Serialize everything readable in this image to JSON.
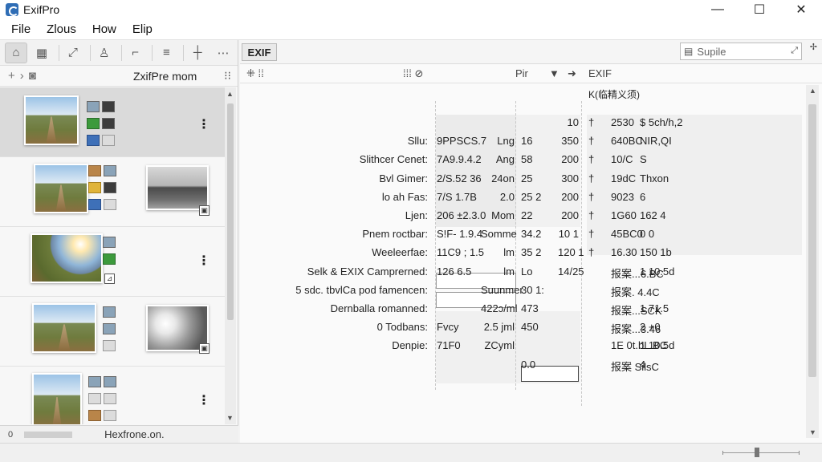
{
  "window": {
    "title": "ExifPro",
    "controls": {
      "minimize": "—",
      "maximize": "☐",
      "close": "✕"
    }
  },
  "menu": [
    "File",
    "Zlous",
    "How",
    "Elip"
  ],
  "left_toolbar": {
    "icons": [
      "home-icon",
      "film-icon",
      "expand-icon",
      "person-icon",
      "crop-icon",
      "list-icon",
      "crosshair-icon",
      "more-icon"
    ]
  },
  "left_subbar": {
    "title": "ZxifPre mom",
    "add": "+",
    "arrow": "›",
    "menu": "⁝⁝"
  },
  "thumbnails": [
    {
      "main": "field",
      "secondary": null,
      "badge": ""
    },
    {
      "main": "field",
      "secondary": "bw",
      "badge": "▣"
    },
    {
      "main": "sun",
      "secondary": null,
      "badge": "⊿"
    },
    {
      "main": "field",
      "secondary": "bw2",
      "badge": "▣"
    },
    {
      "main": "field",
      "secondary": null,
      "badge": ""
    }
  ],
  "left_status": {
    "icon": "0",
    "text": "Hexfrone.on."
  },
  "main": {
    "tab_label": "EXIF",
    "search_placeholder": "Supile",
    "header_icons_left": "⁜  ⁞⁞",
    "header_icons_mid": "⁞⁞⁞  ⊘",
    "header_pin": "Pir",
    "header_right_title": "EXIF",
    "right_subtitle": "K(临精义须)"
  },
  "table_rows": [
    {
      "label": "",
      "v1": "",
      "v2": "",
      "v3": "",
      "v5": "10",
      "dag": "†",
      "v6": "2530",
      "v7": "$ 5ch/h,2"
    },
    {
      "label": "Sllu:",
      "v1": "9PPSCS.7",
      "v2": "Lng",
      "v3": "16",
      "v5": "350",
      "dag": "†",
      "v6": "640BC",
      "v7": "NIR,QI"
    },
    {
      "label": "Slithcer Cenet:",
      "v1": "7A9.9.4.2",
      "v2": "Ang",
      "v3": "58",
      "v5": "200",
      "dag": "†",
      "v6": "10/C",
      "v7": "S"
    },
    {
      "label": "Bvl     Gimer:",
      "v1": "2/S.52 36",
      "v2": "24on",
      "v3": "25",
      "v5": "300",
      "dag": "†",
      "v6": "19dC",
      "v7": "Thxon"
    },
    {
      "label": "lo ah Fas:",
      "v1": "7/S 1.7B",
      "v2": "2.0",
      "v3": "25 2",
      "v5": "200",
      "dag": "†",
      "v6": "9023",
      "v7": "6"
    },
    {
      "label": "Ljen:",
      "v1": "206 ±2.3.0",
      "v2": "Mom",
      "v3": "22",
      "v5": "200",
      "dag": "†",
      "v6": "1G60",
      "v7": "162 4"
    },
    {
      "label": "Pnem roctbar:",
      "v1": "S!F- 1.9.4",
      "v2": "Somme",
      "v3": "34.2",
      "v5": "10 1",
      "dag": "†",
      "v6": "45BC0",
      "v7": "0 0"
    },
    {
      "label": "Weeleerfae:",
      "v1": "11C9 ; 1.5",
      "v2": "lm",
      "v3": "35 2",
      "v5": "120 1",
      "dag": "†",
      "v6": "16.30",
      "v7": "150 1b"
    },
    {
      "label": "Selk & EXIX Camprerned:",
      "v1": "126     6.5",
      "v2": "lm",
      "v3": "Lo",
      "v5": "14/25",
      "dag": "",
      "v6": "报案...6.BC",
      "v7": "1 10.5d"
    },
    {
      "label": "5 sdc. tbvlCa pod famencen:",
      "v1": "",
      "v2": "Suunmer",
      "v3": "30 1:",
      "v5": "",
      "dag": "",
      "v6": "报案. 4.4C",
      "v7": ""
    },
    {
      "label": "Dernballa romanned:",
      "v1": "",
      "v2": "422ɔ/ml",
      "v3": "473",
      "v5": "",
      "dag": "",
      "v6": "报案...SCK",
      "v7": "1 71.5"
    },
    {
      "label": "0     Todbans:",
      "v1": "Fvcy",
      "v2": "2.5 jml",
      "v3": "450",
      "v5": "",
      "dag": "",
      "v6": "报案...3.46",
      "v7": "2 +0"
    },
    {
      "label": "Denpie:",
      "v1": "71F0",
      "v2": "ZCyml",
      "v3": "",
      "v5": "",
      "dag": "",
      "v6": "1E 0t.bL.BC",
      "v7": "1 10.5d"
    },
    {
      "label": "",
      "v1": "",
      "v2": "",
      "v3": "0.0",
      "v5": "",
      "dag": "",
      "v6": "报案 SilsC",
      "v7": "4"
    }
  ]
}
